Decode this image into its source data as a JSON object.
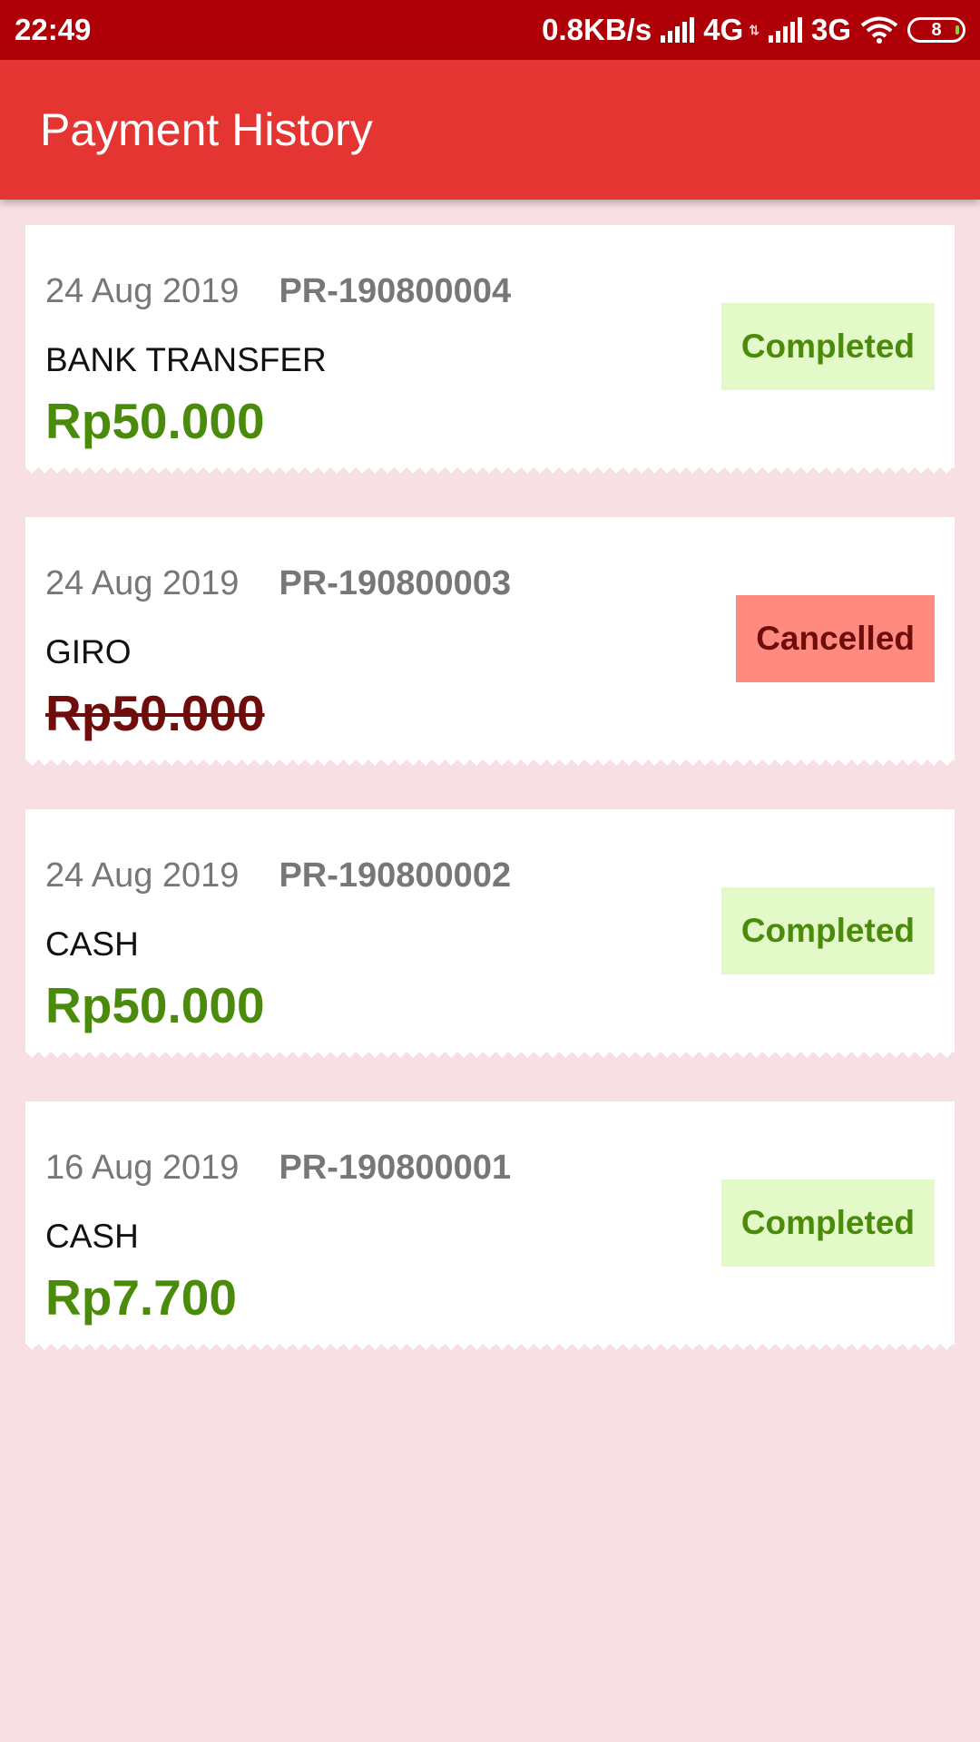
{
  "status_bar": {
    "time": "22:49",
    "network_speed": "0.8KB/s",
    "net1": "4G",
    "net2": "3G",
    "battery": "8"
  },
  "app_bar": {
    "title": "Payment History"
  },
  "payments": [
    {
      "date": "24 Aug 2019",
      "id": "PR-190800004",
      "method": "BANK TRANSFER",
      "amount": "Rp50.000",
      "status": "Completed",
      "status_type": "completed"
    },
    {
      "date": "24 Aug 2019",
      "id": "PR-190800003",
      "method": "GIRO",
      "amount": "Rp50.000",
      "status": "Cancelled",
      "status_type": "cancelled"
    },
    {
      "date": "24 Aug 2019",
      "id": "PR-190800002",
      "method": "CASH",
      "amount": "Rp50.000",
      "status": "Completed",
      "status_type": "completed"
    },
    {
      "date": "16 Aug 2019",
      "id": "PR-190800001",
      "method": "CASH",
      "amount": "Rp7.700",
      "status": "Completed",
      "status_type": "completed"
    }
  ],
  "colors": {
    "status_bar": "#ae0006",
    "app_bar": "#e53532",
    "background": "#f7dfe3",
    "completed_text": "#4b8b0c",
    "completed_bg": "#e3f9c8",
    "cancelled_text": "#6e0d0c",
    "cancelled_bg": "#ff8a80"
  }
}
